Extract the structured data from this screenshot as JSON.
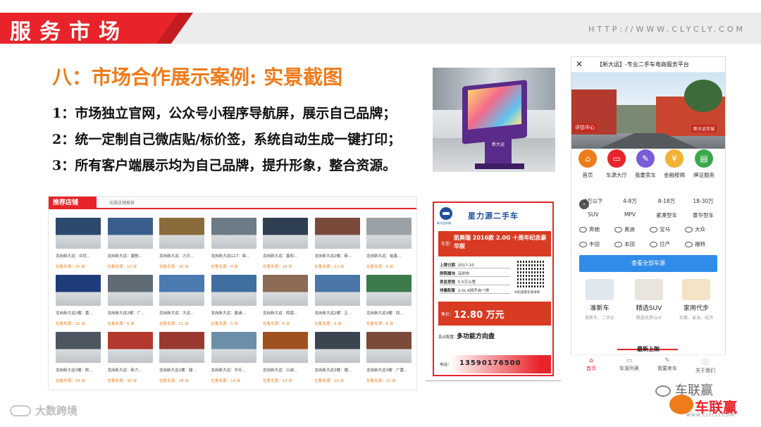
{
  "header": {
    "title": "服务市场",
    "url": "HTTP://WWW.CLYCLY.COM"
  },
  "section": {
    "title": "八：市场合作展示案例: 实景截图",
    "bullets": [
      "1：市场独立官网，公众号小程序导航屏，展示自己品牌；",
      "2：统一定制自己微店贴/标价签，系统自动生成一键打印；",
      "3：所有客户端展示均为自己品牌，提升形象，整合资源。"
    ]
  },
  "kiosk": {
    "stand_text": "新大运"
  },
  "store_panel": {
    "tab": "推荐店铺",
    "subtitle": "优质店铺推荐",
    "cells": [
      {
        "name": "龙岗新大运：众优...",
        "count": "在售车源：15 台",
        "color": "#2c4a6e"
      },
      {
        "name": "龙岗新大运：骏驰...",
        "count": "在售车源：12 台",
        "color": "#3a5f8f"
      },
      {
        "name": "龙岗新大运：力天...",
        "count": "在售车源：16 台",
        "color": "#8a6b3b"
      },
      {
        "name": "龙岗新大运G17：辉...",
        "count": "在售车源：4 台",
        "color": "#6d7b86"
      },
      {
        "name": "龙岗新大运：鑫和...",
        "count": "在售车源：16 台",
        "color": "#2f3f52"
      },
      {
        "name": "龙岗新大运2楼：新...",
        "count": "在售车源：12 台",
        "color": "#7a4b3a"
      },
      {
        "name": "龙岗新大运：裕鑫...",
        "count": "在售车源：9 台",
        "color": "#9aa2a8"
      },
      {
        "name": "龙岗新大运2楼：重...",
        "count": "在售车源：11 台",
        "color": "#1f3c7a"
      },
      {
        "name": "龙岗新大运2楼：广...",
        "count": "在售车源：6 台",
        "color": "#5e6a74"
      },
      {
        "name": "龙岗新大运：大运...",
        "count": "在售车源：21 台",
        "color": "#4b7ab0"
      },
      {
        "name": "龙岗新大运：骏诚...",
        "count": "在售车源：5 台",
        "color": "#3f6fa0"
      },
      {
        "name": "龙岗新大运：辉煌...",
        "count": "在售车源：8 台",
        "color": "#8c6a55"
      },
      {
        "name": "龙岗新大运2楼：正...",
        "count": "在售车源：9 台",
        "color": "#4a76a8"
      },
      {
        "name": "龙岗新大运3楼：四...",
        "count": "在售车源：8 台",
        "color": "#3d7a4c"
      },
      {
        "name": "龙岗新大运3楼：削...",
        "count": "在售车源：14 台",
        "color": "#4d5660"
      },
      {
        "name": "龙岗新大运：新力...",
        "count": "在售车源：32 台",
        "color": "#b3382d"
      },
      {
        "name": "龙岗新大运2楼：骏...",
        "count": "在售车源：28 台",
        "color": "#9a3a2f"
      },
      {
        "name": "龙岗新大运：中天...",
        "count": "在售车源：14 台",
        "color": "#6b8fa8"
      },
      {
        "name": "龙岗新大运：兴诚...",
        "count": "在售车源：23 台",
        "color": "#a0521e"
      },
      {
        "name": "龙岗新大运3楼：捷...",
        "count": "在售车源：10 台",
        "color": "#3a4550"
      },
      {
        "name": "龙岗新大运3楼：广嘉...",
        "count": "在售车源：13 台",
        "color": "#7c4a3a"
      }
    ]
  },
  "price_tag": {
    "logo_caption": "新大运车城",
    "dealer": "星力源二手车",
    "title_label": "车型：",
    "title": "凯美瑞 2016款 2.0G 十周年纪念豪华版",
    "specs": [
      {
        "k": "上牌日期",
        "v": "2017-10"
      },
      {
        "k": "牌照属地",
        "v": "深圳市"
      },
      {
        "k": "表显里程",
        "v": "5.5万公里"
      },
      {
        "k": "排量配置",
        "v": "2.0L 6挡手自一体"
      }
    ],
    "qr_caption": "扫码查看车源详情",
    "price_label": "售价：",
    "price": "12.80 万元",
    "highlight_label": "亮点配置：",
    "highlight": "多功能方向盘",
    "phone_label": "电话：",
    "phone": "13590176500"
  },
  "phone_app": {
    "title": "【新大运】-专业二手车电商服务平台",
    "banner_sign1": "评估中心",
    "banner_sign2": "新大运车城",
    "quick_icons": [
      {
        "label": "首页",
        "color": "#f07b1a",
        "glyph": "⌂"
      },
      {
        "label": "车源大厅",
        "color": "#e8242a",
        "glyph": "▭"
      },
      {
        "label": "我要卖车",
        "color": "#7a5cd6",
        "glyph": "✎"
      },
      {
        "label": "金融按揭",
        "color": "#f2b233",
        "glyph": "¥"
      },
      {
        "label": "牌证服务",
        "color": "#3aa84a",
        "glyph": "▤"
      }
    ],
    "prices": [
      "4万以下",
      "4-8万",
      "8-18万",
      "18-30万"
    ],
    "types": [
      "SUV",
      "MPV",
      "紧凑型车",
      "豪华型车"
    ],
    "brands": [
      "奔驰",
      "奥迪",
      "宝马",
      "大众",
      "丰田",
      "本田",
      "日产",
      "福特"
    ],
    "view_all": "查看全部车源",
    "features": [
      {
        "title": "准新车",
        "sub": "准新车，二手价",
        "color": "#dfe7ef"
      },
      {
        "title": "精选SUV",
        "sub": "精选优质SUV",
        "color": "#e9e4dc"
      },
      {
        "title": "家用代步",
        "sub": "实惠、省油、经济",
        "color": "#f4e3c4"
      }
    ],
    "latest": "最新上架",
    "tabs": [
      {
        "label": "首页",
        "glyph": "⌂"
      },
      {
        "label": "车源列表",
        "glyph": "▭"
      },
      {
        "label": "我要卖车",
        "glyph": "✎"
      },
      {
        "label": "关于我们",
        "glyph": "ⓘ"
      }
    ]
  },
  "footer": {
    "left_watermark": "大数跨境",
    "wechat": "车联赢",
    "brand": "车联赢",
    "brand_url": "WWW.CLYCLY.COM"
  },
  "colors": {
    "accent": "#e8242a",
    "orange": "#f07b1a",
    "blue": "#2f8ce8"
  }
}
